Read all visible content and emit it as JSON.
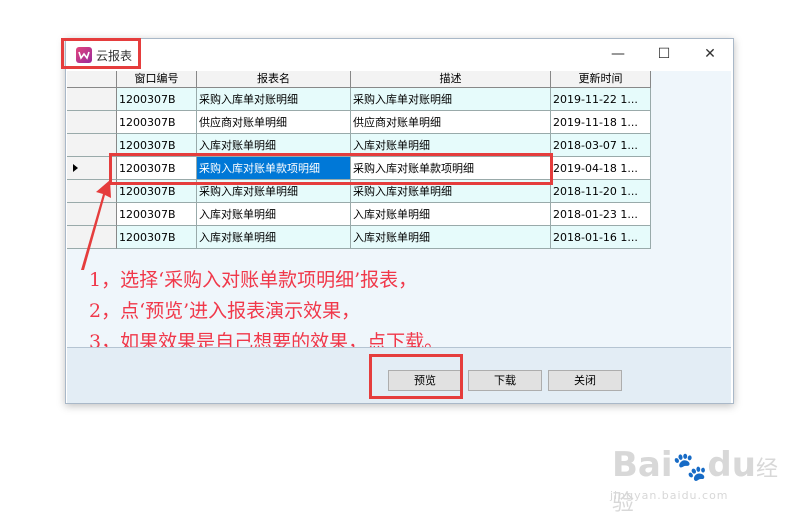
{
  "window": {
    "title": "云报表",
    "controls": {
      "minimize": "—",
      "maximize": "☐",
      "close": "✕"
    }
  },
  "table": {
    "headers": [
      "窗口编号",
      "报表名",
      "描述",
      "更新时间"
    ],
    "rows": [
      {
        "id": "1200307B",
        "name": "采购入库单对账明细",
        "desc": "采购入库单对账明细",
        "time": "2019-11-22 1..."
      },
      {
        "id": "1200307B",
        "name": "供应商对账单明细",
        "desc": "供应商对账单明细",
        "time": "2019-11-18 1..."
      },
      {
        "id": "1200307B",
        "name": "入库对账单明细",
        "desc": "入库对账单明细",
        "time": "2018-03-07 1..."
      },
      {
        "id": "1200307B",
        "name": "采购入库对账单款项明细",
        "desc": "采购入库对账单款项明细",
        "time": "2019-04-18 1..."
      },
      {
        "id": "1200307B",
        "name": "采购入库对账单明细",
        "desc": "采购入库对账单明细",
        "time": "2018-11-20 1..."
      },
      {
        "id": "1200307B",
        "name": "入库对账单明细",
        "desc": "入库对账单明细",
        "time": "2018-01-23 1..."
      },
      {
        "id": "1200307B",
        "name": "入库对账单明细",
        "desc": "入库对账单明细",
        "time": "2018-01-16 1..."
      }
    ],
    "selected_row": 3
  },
  "annotations": [
    "1，选择‘采购入对账单款项明细’报表，",
    "2，点‘预览’进入报表演示效果，",
    "3，如果效果是自己想要的效果，点下载。"
  ],
  "buttons": {
    "preview": "预览",
    "download": "下载",
    "close": "关闭"
  },
  "watermark": {
    "brand": "Bai",
    "brand2": "du",
    "brand_cn": "经验",
    "url": "jingyan.baidu.com"
  },
  "colors": {
    "highlight": "#e53d3d",
    "annotation": "#f0384a",
    "row_alt": "#e6fbfb",
    "selection": "#0078d7"
  }
}
